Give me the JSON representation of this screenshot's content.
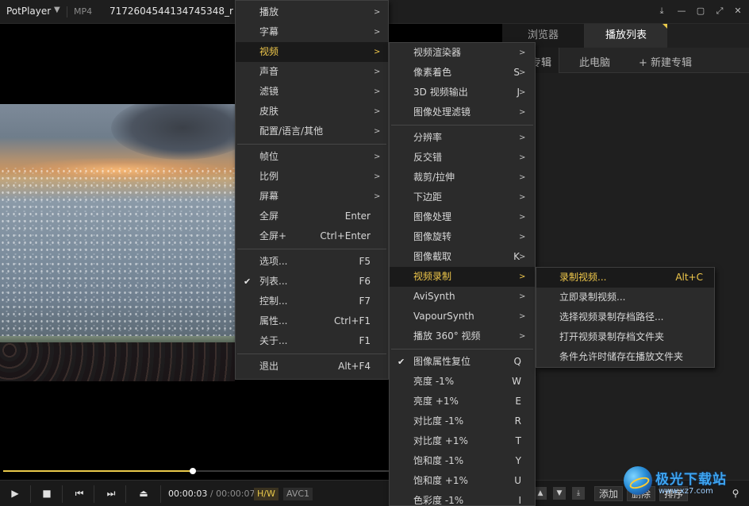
{
  "title_bar": {
    "brand": "PotPlayer",
    "format": "MP4",
    "filename": "7172604544134745348_r (1",
    "buttons": [
      "pin-icon",
      "minimize-icon",
      "maximize-icon",
      "fullscreen-icon",
      "close-icon"
    ]
  },
  "panel": {
    "tabs": [
      "浏览器",
      "播放列表"
    ],
    "active_tab": "播放列表",
    "subtabs": [
      "专辑",
      "此电脑",
      "+ 新建专辑"
    ]
  },
  "main_menu": {
    "items": [
      {
        "label": "播放",
        "submenu": true
      },
      {
        "label": "字幕",
        "submenu": true
      },
      {
        "label": "视频",
        "submenu": true,
        "highlighted": true
      },
      {
        "label": "声音",
        "submenu": true
      },
      {
        "label": "滤镜",
        "submenu": true
      },
      {
        "label": "皮肤",
        "submenu": true
      },
      {
        "label": "配置/语言/其他",
        "submenu": true
      },
      {
        "separator": true
      },
      {
        "label": "帧位",
        "submenu": true
      },
      {
        "label": "比例",
        "submenu": true
      },
      {
        "label": "屏幕",
        "submenu": true
      },
      {
        "label": "全屏",
        "shortcut": "Enter"
      },
      {
        "label": "全屏+",
        "shortcut": "Ctrl+Enter"
      },
      {
        "separator": true
      },
      {
        "label": "选项...",
        "shortcut": "F5"
      },
      {
        "label": "列表...",
        "shortcut": "F6",
        "checked": true
      },
      {
        "label": "控制...",
        "shortcut": "F7"
      },
      {
        "label": "属性...",
        "shortcut": "Ctrl+F1"
      },
      {
        "label": "关于...",
        "shortcut": "F1"
      },
      {
        "separator": true
      },
      {
        "label": "退出",
        "shortcut": "Alt+F4"
      }
    ]
  },
  "video_menu": {
    "items": [
      {
        "label": "视频渲染器",
        "submenu": true
      },
      {
        "label": "像素着色",
        "shortcut": "S",
        "submenu": true
      },
      {
        "label": "3D 视频输出",
        "shortcut": "J",
        "submenu": true
      },
      {
        "label": "图像处理滤镜",
        "submenu": true
      },
      {
        "separator": true
      },
      {
        "label": "分辨率",
        "submenu": true
      },
      {
        "label": "反交错",
        "submenu": true
      },
      {
        "label": "裁剪/拉伸",
        "submenu": true
      },
      {
        "label": "下边距",
        "submenu": true
      },
      {
        "label": "图像处理",
        "submenu": true
      },
      {
        "label": "图像旋转",
        "submenu": true
      },
      {
        "label": "图像截取",
        "shortcut": "K",
        "submenu": true
      },
      {
        "label": "视频录制",
        "submenu": true,
        "highlighted": true
      },
      {
        "label": "AviSynth",
        "submenu": true
      },
      {
        "label": "VapourSynth",
        "submenu": true
      },
      {
        "label": "播放 360° 视频",
        "submenu": true
      },
      {
        "separator": true
      },
      {
        "label": "图像属性复位",
        "shortcut": "Q",
        "checked": true
      },
      {
        "label": "亮度 -1%",
        "shortcut": "W"
      },
      {
        "label": "亮度 +1%",
        "shortcut": "E"
      },
      {
        "label": "对比度 -1%",
        "shortcut": "R"
      },
      {
        "label": "对比度 +1%",
        "shortcut": "T"
      },
      {
        "label": "饱和度 -1%",
        "shortcut": "Y"
      },
      {
        "label": "饱和度 +1%",
        "shortcut": "U"
      },
      {
        "label": "色彩度 -1%",
        "shortcut": "I"
      }
    ]
  },
  "record_menu": {
    "items": [
      {
        "label": "录制视频...",
        "shortcut": "Alt+C",
        "highlighted": true
      },
      {
        "label": "立即录制视频..."
      },
      {
        "label": "选择视频录制存档路径..."
      },
      {
        "label": "打开视频录制存档文件夹"
      },
      {
        "label": "条件允许时储存在播放文件夹"
      }
    ]
  },
  "playback": {
    "current_time": "00:00:03",
    "total_time": "00:00:07",
    "progress": 0.38,
    "hw_badge": "H/W",
    "codec": "AVC1"
  },
  "playlist_controls": {
    "add": "添加",
    "delete": "删除",
    "sort": "排序"
  },
  "watermark": {
    "text": "极光下载站",
    "url": "www.xz7.com"
  },
  "colors": {
    "accent": "#e8c84a",
    "menu_bg": "#2b2b2b",
    "menu_highlight_text": "#f0c84b"
  }
}
